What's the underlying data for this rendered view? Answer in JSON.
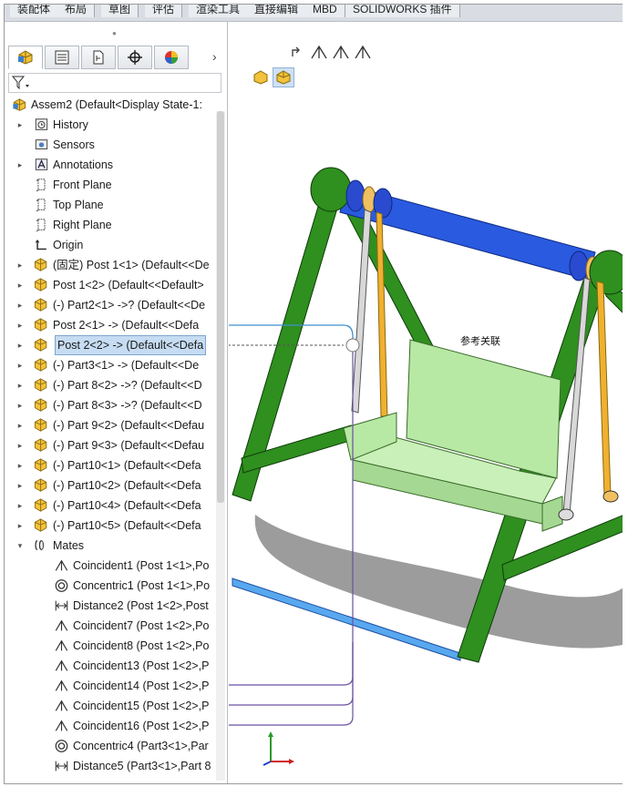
{
  "tabs": [
    "装配体",
    "布局",
    "草图",
    "评估",
    "渲染工具",
    "直接编辑",
    "MBD",
    "SOLIDWORKS 插件"
  ],
  "panel_tabs": [
    "featuremanager-tab",
    "propertymanager-tab",
    "configurationmanager-tab",
    "dimxpert-tab",
    "display-manager-tab"
  ],
  "root": {
    "label": "Assem2  (Default<Display State-1:"
  },
  "tree": [
    {
      "label": "History",
      "icon": "history-icon",
      "exp": "▸",
      "indent": 1
    },
    {
      "label": "Sensors",
      "icon": "sensors-icon",
      "exp": "",
      "indent": 1
    },
    {
      "label": "Annotations",
      "icon": "annotations-icon",
      "exp": "▸",
      "indent": 1
    },
    {
      "label": "Front Plane",
      "icon": "plane-icon",
      "exp": "",
      "indent": 1
    },
    {
      "label": "Top Plane",
      "icon": "plane-icon",
      "exp": "",
      "indent": 1
    },
    {
      "label": "Right Plane",
      "icon": "plane-icon",
      "exp": "",
      "indent": 1
    },
    {
      "label": "Origin",
      "icon": "origin-icon",
      "exp": "",
      "indent": 1
    },
    {
      "label": "(固定) Post 1<1> (Default<<De",
      "icon": "part-icon",
      "exp": "▸",
      "indent": 1
    },
    {
      "label": "Post 1<2> (Default<<Default>",
      "icon": "part-icon",
      "exp": "▸",
      "indent": 1
    },
    {
      "label": "(-) Part2<1> ->? (Default<<De",
      "icon": "part-icon",
      "exp": "▸",
      "indent": 1
    },
    {
      "label": "Post 2<1> -> (Default<<Defa",
      "icon": "part-icon",
      "exp": "▸",
      "indent": 1
    },
    {
      "label": "Post 2<2> -> (Default<<Defa",
      "icon": "part-icon",
      "exp": "▸",
      "indent": 1,
      "selected": true
    },
    {
      "label": "(-) Part3<1> -> (Default<<De",
      "icon": "part-icon",
      "exp": "▸",
      "indent": 1
    },
    {
      "label": "(-) Part 8<2> ->? (Default<<D",
      "icon": "part-icon",
      "exp": "▸",
      "indent": 1
    },
    {
      "label": "(-) Part 8<3> ->? (Default<<D",
      "icon": "part-icon",
      "exp": "▸",
      "indent": 1
    },
    {
      "label": "(-) Part 9<2> (Default<<Defau",
      "icon": "part-icon",
      "exp": "▸",
      "indent": 1
    },
    {
      "label": "(-) Part 9<3> (Default<<Defau",
      "icon": "part-icon",
      "exp": "▸",
      "indent": 1
    },
    {
      "label": "(-) Part10<1> (Default<<Defa",
      "icon": "part-icon",
      "exp": "▸",
      "indent": 1
    },
    {
      "label": "(-) Part10<2> (Default<<Defa",
      "icon": "part-icon",
      "exp": "▸",
      "indent": 1
    },
    {
      "label": "(-) Part10<4> (Default<<Defa",
      "icon": "part-icon",
      "exp": "▸",
      "indent": 1
    },
    {
      "label": "(-) Part10<5> (Default<<Defa",
      "icon": "part-icon",
      "exp": "▸",
      "indent": 1
    },
    {
      "label": "Mates",
      "icon": "mates-icon",
      "exp": "▾",
      "indent": 1
    },
    {
      "label": "Coincident1 (Post 1<1>,Po",
      "icon": "coincident-icon",
      "exp": "",
      "indent": 2
    },
    {
      "label": "Concentric1 (Post 1<1>,Po",
      "icon": "concentric-icon",
      "exp": "",
      "indent": 2
    },
    {
      "label": "Distance2 (Post 1<2>,Post",
      "icon": "distance-icon",
      "exp": "",
      "indent": 2
    },
    {
      "label": "Coincident7 (Post 1<2>,Po",
      "icon": "coincident-icon",
      "exp": "",
      "indent": 2
    },
    {
      "label": "Coincident8 (Post 1<2>,Po",
      "icon": "coincident-icon",
      "exp": "",
      "indent": 2
    },
    {
      "label": "Coincident13 (Post 1<2>,P",
      "icon": "coincident-icon",
      "exp": "",
      "indent": 2
    },
    {
      "label": "Coincident14 (Post 1<2>,P",
      "icon": "coincident-icon",
      "exp": "",
      "indent": 2
    },
    {
      "label": "Coincident15 (Post 1<2>,P",
      "icon": "coincident-icon",
      "exp": "",
      "indent": 2
    },
    {
      "label": "Coincident16 (Post 1<2>,P",
      "icon": "coincident-icon",
      "exp": "",
      "indent": 2
    },
    {
      "label": "Concentric4 (Part3<1>,Par",
      "icon": "concentric-icon",
      "exp": "",
      "indent": 2
    },
    {
      "label": "Distance5 (Part3<1>,Part 8",
      "icon": "distance-icon",
      "exp": "",
      "indent": 2
    }
  ],
  "callout": {
    "label": "参考关联"
  },
  "colors": {
    "frame_green": "#2f8f1f",
    "bar_blue": "#2a5ae0",
    "seat_green": "#b7e8a4",
    "part_yellow": "#f0c020",
    "mate_line": "#6a4fa0",
    "callout_line": "#3d8fd0"
  }
}
